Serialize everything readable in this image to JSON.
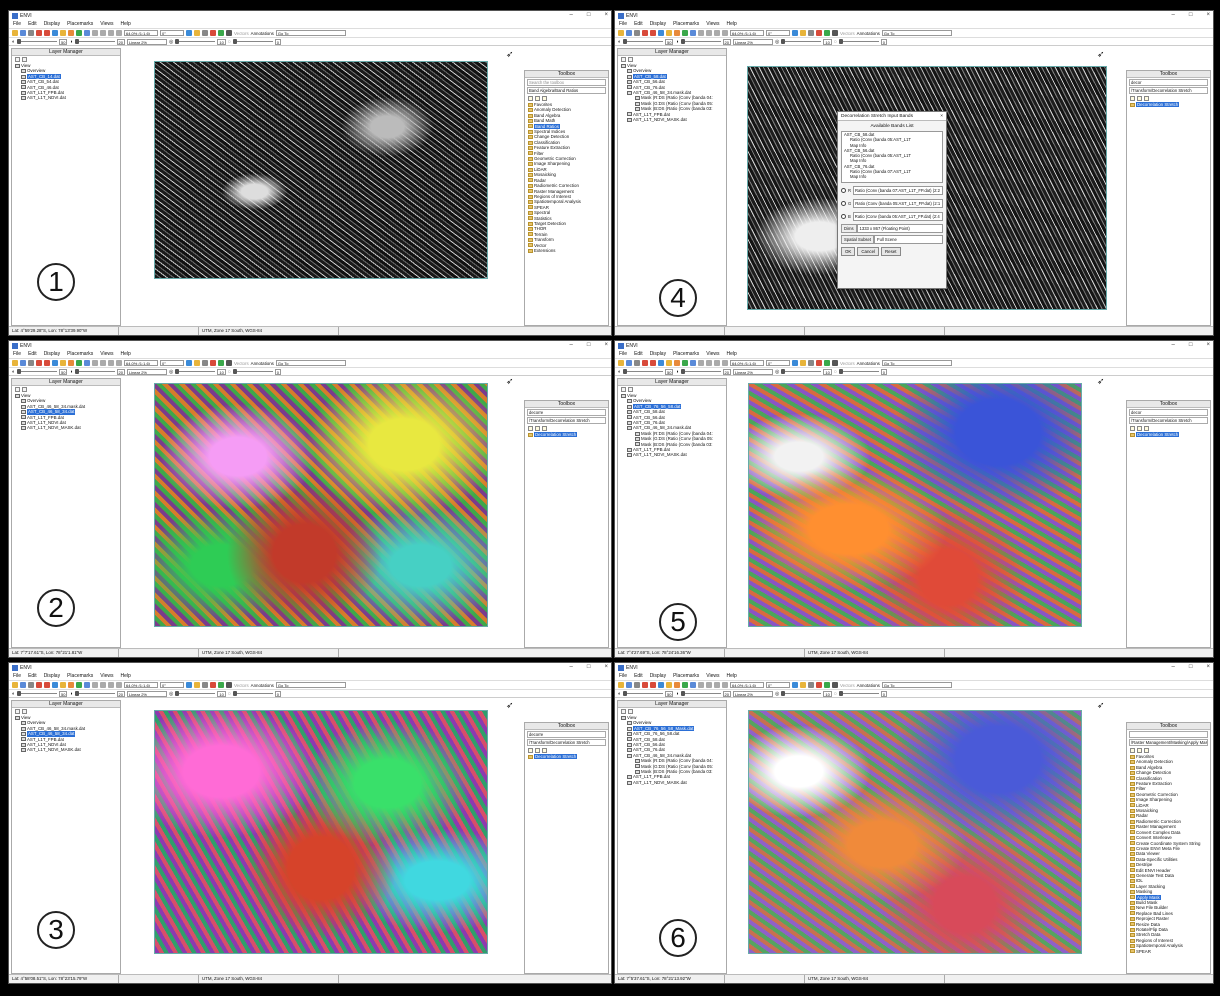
{
  "app_title": "ENVI",
  "menu": [
    "File",
    "Edit",
    "Display",
    "Placemarks",
    "Views",
    "Help"
  ],
  "toolbar": {
    "zoom_value": "64.0% (1:1.6)",
    "rotation_value": "0°",
    "vectors_label": "Vectors",
    "annotations_label": "Annotations",
    "goto_label": "Go To"
  },
  "toolbar2": {
    "brightness": "50",
    "contrast": "20",
    "stretch_value": "Linear 2%",
    "sharpen": "10",
    "transparency": "0"
  },
  "layer_manager_title": "Layer Manager",
  "toolbox_title": "Toolbox",
  "panels": [
    {
      "num": "1",
      "layers": [
        "View",
        "Overview",
        "AST_CB_14.dat",
        "AST_CB_54.dat",
        "AST_CB_46.dat",
        "AST_L1T_FPB.dat",
        "AST_L1T_NDVI.dat"
      ],
      "selected": 2,
      "toolbox_search": "Search the toolbox",
      "toolbox_path": "Band Algebra/Band Ratios",
      "toolbox_items": [
        "Favorites",
        "Anomaly Detection",
        "Band Algebra",
        "Band Math",
        "Band Ratios",
        "Spectral Indices",
        "Change Detection",
        "Classification",
        "Feature Extraction",
        "Filter",
        "Geometric Correction",
        "Image Sharpening",
        "LiDAR",
        "Mosaicking",
        "Radar",
        "Radiometric Correction",
        "Raster Management",
        "Regions of Interest",
        "Spatiotemporal Analysis",
        "SPEAR",
        "Spectral",
        "Statistics",
        "Target Detection",
        "THOR",
        "Terrain",
        "Transform",
        "Vector",
        "Extensions"
      ],
      "toolbox_selected": 4,
      "status": [
        "Lat: 4°59'29.28\"S, Lon: 78°13'39.90\"W",
        "",
        "UTM, Zone 17 South, WGS-84"
      ]
    },
    {
      "num": "2",
      "layers": [
        "View",
        "Overview",
        "AST_CB_46_58_34.mask.dat",
        "AST_CB_46_58_34.dat",
        "AST_L1T_FPB.dat",
        "AST_L1T_NDVI.dat",
        "AST_L1T_NDVI_MASK.dat"
      ],
      "selected": 3,
      "toolbox_search": "decorre",
      "toolbox_path": "/Transform/Decorrelation Stretch",
      "toolbox_items": [
        "Decorrelation Stretch"
      ],
      "toolbox_selected": 0,
      "status": [
        "Lat: 7°7'17.61\"S, Lon: 78°21'1.81\"W",
        "",
        "UTM, Zone 17 South, WGS-84"
      ]
    },
    {
      "num": "3",
      "layers": [
        "View",
        "Overview",
        "AST_CB_46_58_34.mask.dat",
        "AST_CB_46_58_34.dat",
        "AST_L1T_FPB.dat",
        "AST_L1T_NDVI.dat",
        "AST_L1T_NDVI_MASK.dat"
      ],
      "selected": 3,
      "toolbox_search": "decorre",
      "toolbox_path": "/Transform/Decorrelation Stretch",
      "toolbox_items": [
        "Decorrelation Stretch"
      ],
      "toolbox_selected": 0,
      "status": [
        "Lat: 4°58'08.51\"S, Lon: 78°23'15.79\"W",
        "",
        "UTM, Zone 17 South, WGS-84"
      ]
    },
    {
      "num": "4",
      "layers": [
        "View",
        "Overview",
        "AST_CB_58.dat",
        "AST_CB_56.dat",
        "AST_CB_76.dat",
        "AST_CB_46_58_34.mask.dat",
        "Mask (R:DS (Ratio (Conv (banda 04:",
        "Mask (G:DS (Ratio (Conv (banda 05:",
        "Mask (B:DS (Ratio (Conv (banda 03:",
        "AST_L1T_FPB.dat",
        "AST_L1T_NDVI_MASK.dat"
      ],
      "selected": 2,
      "toolbox_search": "decor",
      "toolbox_path": "/Transform/Decorrelation Stretch",
      "toolbox_items": [
        "Decorrelation Stretch"
      ],
      "toolbox_selected": 0,
      "status": [
        "",
        "",
        ""
      ],
      "dialog": {
        "title": "Decorrelation Stretch Input Bands",
        "list_label": "Available Bands List",
        "bands": [
          "AST_CB_58.dat",
          "Ratio (Conv (banda 05:AST_L1T",
          "Map Info",
          "AST_CB_56.dat",
          "Ratio (Conv (banda 05:AST_L1T",
          "Map Info",
          "AST_CB_76.dat",
          "Ratio (Conv (banda 07:AST_L1T",
          "Map Info"
        ],
        "r_label": "R",
        "g_label": "G",
        "b_label": "B",
        "r": "Ratio (Conv (banda 07:AST_L1T_FP.dat) (2:2",
        "g": "Ratio (Conv (banda 05:AST_L1T_FP.dat) (2:1",
        "b": "Ratio (Conv (banda 05:AST_L1T_FP.dat) (2:4",
        "dims_label": "Dims",
        "dims": "1333 x 867 (Floating Point)",
        "subset_label": "Spatial Subset",
        "subset": "Full Scene",
        "buttons": [
          "OK",
          "Cancel",
          "Reset"
        ]
      }
    },
    {
      "num": "5",
      "layers": [
        "View",
        "Overview",
        "AST_CB_76_56_58.dat",
        "AST_CB_58.dat",
        "AST_CB_56.dat",
        "AST_CB_76.dat",
        "AST_CB_46_58_34.mask.dat",
        "Mask (R:DS (Ratio (Conv (banda 04:",
        "Mask (G:DS (Ratio (Conv (banda 05:",
        "Mask (B:DS (Ratio (Conv (banda 03:",
        "AST_L1T_FPB.dat",
        "AST_L1T_NDVI_MASK.dat"
      ],
      "selected": 2,
      "toolbox_search": "decor",
      "toolbox_path": "/Transform/Decorrelation Stretch",
      "toolbox_items": [
        "Decorrelation Stretch"
      ],
      "toolbox_selected": 0,
      "status": [
        "Lat: 7°4'27.69\"S, Lon: 78°24'16.36\"W",
        "",
        "UTM, Zone 17 South, WGS-84"
      ]
    },
    {
      "num": "6",
      "layers": [
        "View",
        "Overview",
        "AST_CB_76_56_58_Mask.dat",
        "AST_CB_76_56_58.dat",
        "AST_CB_58.dat",
        "AST_CB_56.dat",
        "AST_CB_76.dat",
        "AST_CB_46_58_34.mask.dat",
        "Mask (R:DS (Ratio (Conv (banda 04:",
        "Mask (G:DS (Ratio (Conv (banda 05:",
        "Mask (B:DS (Ratio (Conv (banda 03:",
        "AST_L1T_FPB.dat",
        "AST_L1T_NDVI_MASK.dat"
      ],
      "selected": 2,
      "toolbox_search": "",
      "toolbox_path": "/Raster Management/Masking/Apply Mask",
      "toolbox_items": [
        "Favorites",
        "Anomaly Detection",
        "Band Algebra",
        "Change Detection",
        "Classification",
        "Feature Extraction",
        "Filter",
        "Geometric Correction",
        "Image Sharpening",
        "LiDAR",
        "Mosaicking",
        "Radar",
        "Radiometric Correction",
        "Raster Management",
        "Convert Complex Data",
        "Convert Interleave",
        "Create Coordinate System String",
        "Create ENVI Meta File",
        "Data Viewer",
        "Data-Specific Utilities",
        "Destripe",
        "Edit ENVI Header",
        "Generate Test Data",
        "IDL",
        "Layer Stacking",
        "Masking",
        "Apply Mask",
        "Build Mask",
        "New File Builder",
        "Replace Bad Lines",
        "Reproject Raster",
        "Resize Data",
        "Rotate/Flip Data",
        "Stretch Data",
        "Regions of Interest",
        "Spatiotemporal Analysis",
        "SPEAR"
      ],
      "toolbox_selected": 26,
      "status": [
        "Lat: 7°5'37.61\"S, Lon: 78°21'13.92\"W",
        "",
        "UTM, Zone 17 South, WGS-84"
      ]
    }
  ]
}
